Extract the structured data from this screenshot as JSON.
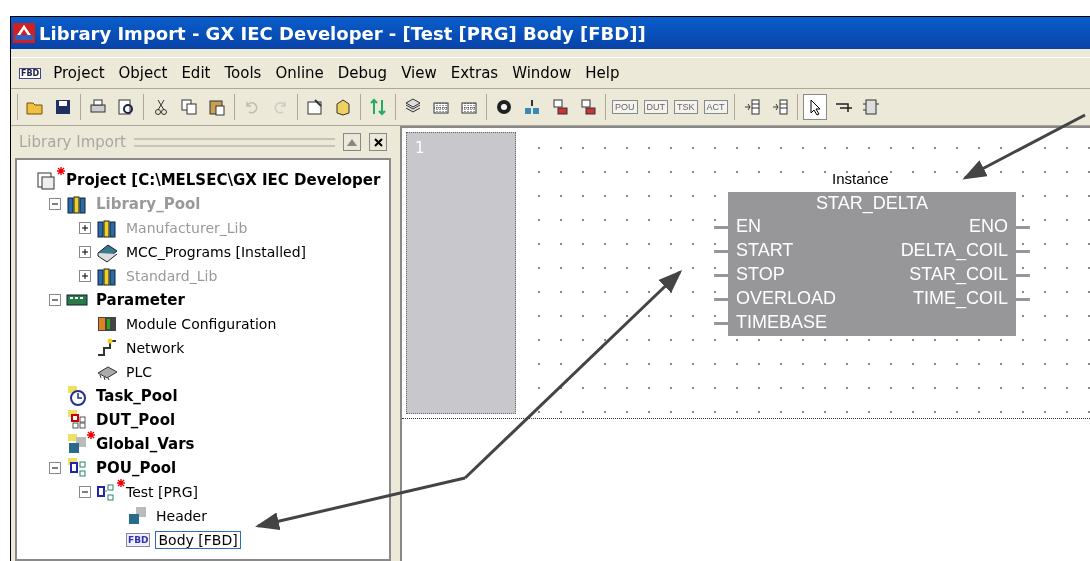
{
  "window": {
    "title": "Library Import - GX IEC Developer - [Test [PRG] Body [FBD]]"
  },
  "menu": {
    "doc_icon_text": "FBD",
    "items": [
      {
        "label": "Project"
      },
      {
        "label": "Object"
      },
      {
        "label": "Edit"
      },
      {
        "label": "Tools"
      },
      {
        "label": "Online"
      },
      {
        "label": "Debug"
      },
      {
        "label": "View"
      },
      {
        "label": "Extras"
      },
      {
        "label": "Window"
      },
      {
        "label": "Help"
      }
    ]
  },
  "toolbar": [
    [
      {
        "kind": "open",
        "disabled": false
      },
      {
        "kind": "save",
        "disabled": false
      }
    ],
    [
      {
        "kind": "print",
        "disabled": false
      },
      {
        "kind": "preview",
        "disabled": false
      }
    ],
    [
      {
        "kind": "cut",
        "disabled": false
      },
      {
        "kind": "copy",
        "disabled": false
      },
      {
        "kind": "paste",
        "disabled": false
      }
    ],
    [
      {
        "kind": "undo",
        "disabled": true
      },
      {
        "kind": "redo",
        "disabled": true
      }
    ],
    [
      {
        "kind": "properties",
        "disabled": false
      },
      {
        "kind": "object",
        "disabled": false
      }
    ],
    [
      {
        "kind": "exchange",
        "disabled": false
      }
    ],
    [
      {
        "kind": "stack",
        "disabled": false
      },
      {
        "kind": "grid",
        "disabled": false
      },
      {
        "kind": "grid",
        "disabled": false
      }
    ],
    [
      {
        "kind": "compile",
        "disabled": false
      },
      {
        "kind": "transfer",
        "disabled": false
      },
      {
        "kind": "network",
        "disabled": false
      },
      {
        "kind": "network",
        "disabled": false
      }
    ],
    [
      {
        "kind": "text",
        "label": "POU",
        "disabled": true
      },
      {
        "kind": "text",
        "label": "DUT",
        "disabled": true
      },
      {
        "kind": "text",
        "label": "TSK",
        "disabled": true
      },
      {
        "kind": "text",
        "label": "ACT",
        "disabled": true
      }
    ],
    [
      {
        "kind": "insert",
        "disabled": false
      },
      {
        "kind": "insert",
        "disabled": false
      }
    ],
    [
      {
        "kind": "pointer",
        "disabled": false,
        "selected": true
      },
      {
        "kind": "wire",
        "disabled": false,
        "selected": false
      },
      {
        "kind": "block",
        "disabled": false,
        "selected": false
      }
    ]
  ],
  "panel": {
    "title": "Library Import",
    "tree": [
      {
        "label": "Project [C:\\MELSEC\\GX IEC Developer",
        "kind": "project",
        "modified": true,
        "disabled": false,
        "selected": false,
        "children": [
          {
            "label": "Library_Pool",
            "kind": "library",
            "expanded": true,
            "modified": false,
            "disabled": true,
            "selected": false,
            "children": [
              {
                "label": "Manufacturer_Lib",
                "kind": "library",
                "expanded": false,
                "modified": false,
                "disabled": true,
                "selected": false
              },
              {
                "label": "MCC_Programs [Installed]",
                "kind": "book",
                "expanded": false,
                "modified": false,
                "disabled": false,
                "selected": false
              },
              {
                "label": "Standard_Lib",
                "kind": "library",
                "expanded": false,
                "modified": false,
                "disabled": true,
                "selected": false
              }
            ]
          },
          {
            "label": "Parameter",
            "kind": "parameter",
            "expanded": true,
            "modified": false,
            "disabled": false,
            "selected": false,
            "children": [
              {
                "label": "Module Configuration",
                "kind": "module",
                "modified": false,
                "disabled": false,
                "selected": false
              },
              {
                "label": "Network",
                "kind": "network",
                "modified": false,
                "disabled": false,
                "selected": false
              },
              {
                "label": "PLC",
                "kind": "plc",
                "modified": false,
                "disabled": false,
                "selected": false
              }
            ]
          },
          {
            "label": "Task_Pool",
            "kind": "task",
            "modified": false,
            "disabled": false,
            "selected": false
          },
          {
            "label": "DUT_Pool",
            "kind": "dut",
            "modified": false,
            "disabled": false,
            "selected": false
          },
          {
            "label": "Global_Vars",
            "kind": "vars",
            "modified": true,
            "disabled": false,
            "selected": false
          },
          {
            "label": "POU_Pool",
            "kind": "pou",
            "expanded": true,
            "modified": false,
            "disabled": false,
            "selected": false,
            "children": [
              {
                "label": "Test [PRG]",
                "kind": "prg",
                "expanded": true,
                "modified": true,
                "disabled": false,
                "selected": false,
                "children": [
                  {
                    "label": "Header",
                    "kind": "header",
                    "modified": false,
                    "disabled": false,
                    "selected": false
                  },
                  {
                    "label": "Body [FBD]",
                    "kind": "fbd",
                    "icon_text": "FBD",
                    "modified": false,
                    "disabled": false,
                    "selected": true
                  }
                ]
              }
            ]
          }
        ]
      }
    ]
  },
  "editor": {
    "network_number": "1",
    "block": {
      "instance": "Instance",
      "type": "STAR_DELTA",
      "inputs": [
        "EN",
        "START",
        "STOP",
        "OVERLOAD",
        "TIMEBASE"
      ],
      "outputs": [
        "ENO",
        "DELTA_COIL",
        "STAR_COIL",
        "TIME_COIL"
      ]
    }
  }
}
